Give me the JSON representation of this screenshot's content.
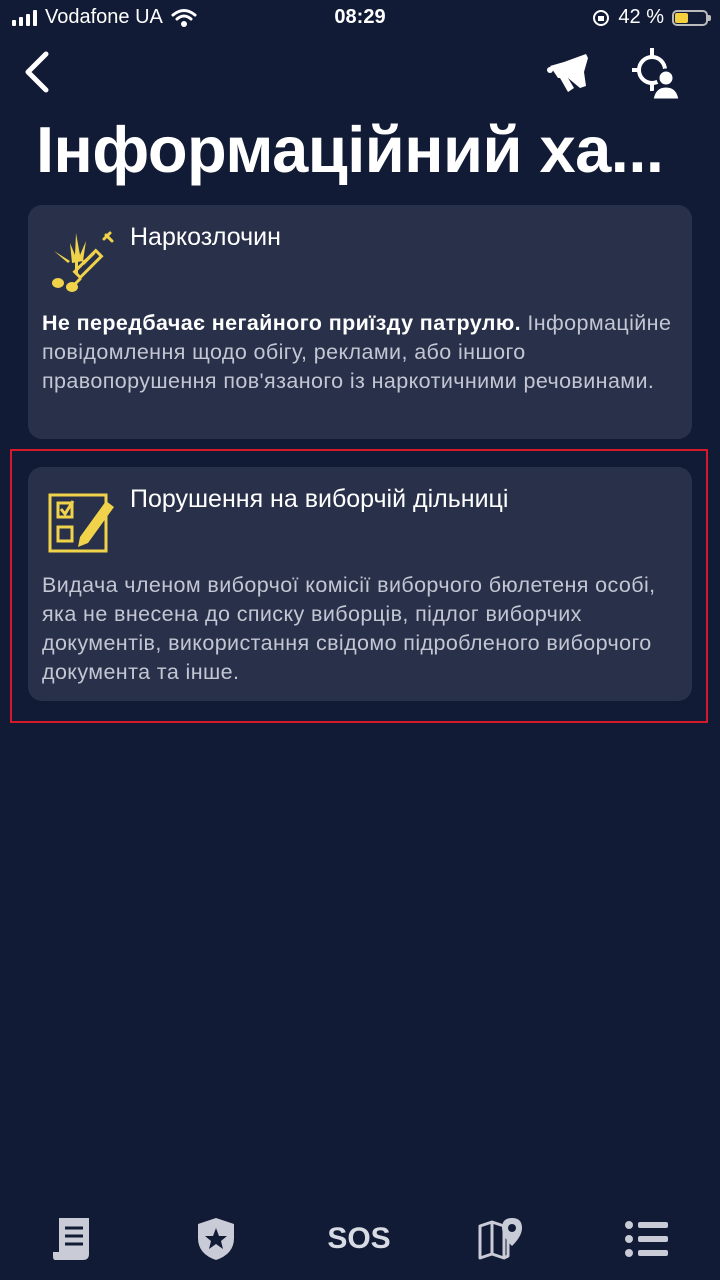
{
  "status_bar": {
    "carrier": "Vodafone UA",
    "time": "08:29",
    "battery_percent": "42 %",
    "battery_level": 0.42
  },
  "nav": {
    "back_icon": "chevron-left-icon",
    "action_icons": [
      "megaphone-icon",
      "location-person-icon"
    ]
  },
  "page": {
    "title": "Інформаційний ха..."
  },
  "cards": [
    {
      "icon": "cannabis-syringe-icon",
      "title": "Наркозлочин",
      "bold_note": "Не передбачає негайного приїзду патрулю.",
      "description": "Інформаційне повідомлення щодо обігу, реклами, або іншого правопорушення пов'язаного із наркотичними речовинами."
    },
    {
      "icon": "checklist-pen-icon",
      "title": "Порушення на виборчій дільниці",
      "description": "Видача членом виборчої комісії виборчого бюлетеня особі, яка не внесена до списку виборців, підлог виборчих документів, використання свідомо підробленого виборчого документа та інше."
    }
  ],
  "tabbar": {
    "items": [
      {
        "icon": "document-list-icon"
      },
      {
        "icon": "police-badge-icon"
      },
      {
        "label": "SOS"
      },
      {
        "icon": "map-pin-icon"
      },
      {
        "icon": "menu-list-icon"
      }
    ]
  },
  "colors": {
    "background": "#121b36",
    "card": "#293049",
    "accent_yellow": "#f0d34a",
    "highlight": "#d5192a"
  }
}
